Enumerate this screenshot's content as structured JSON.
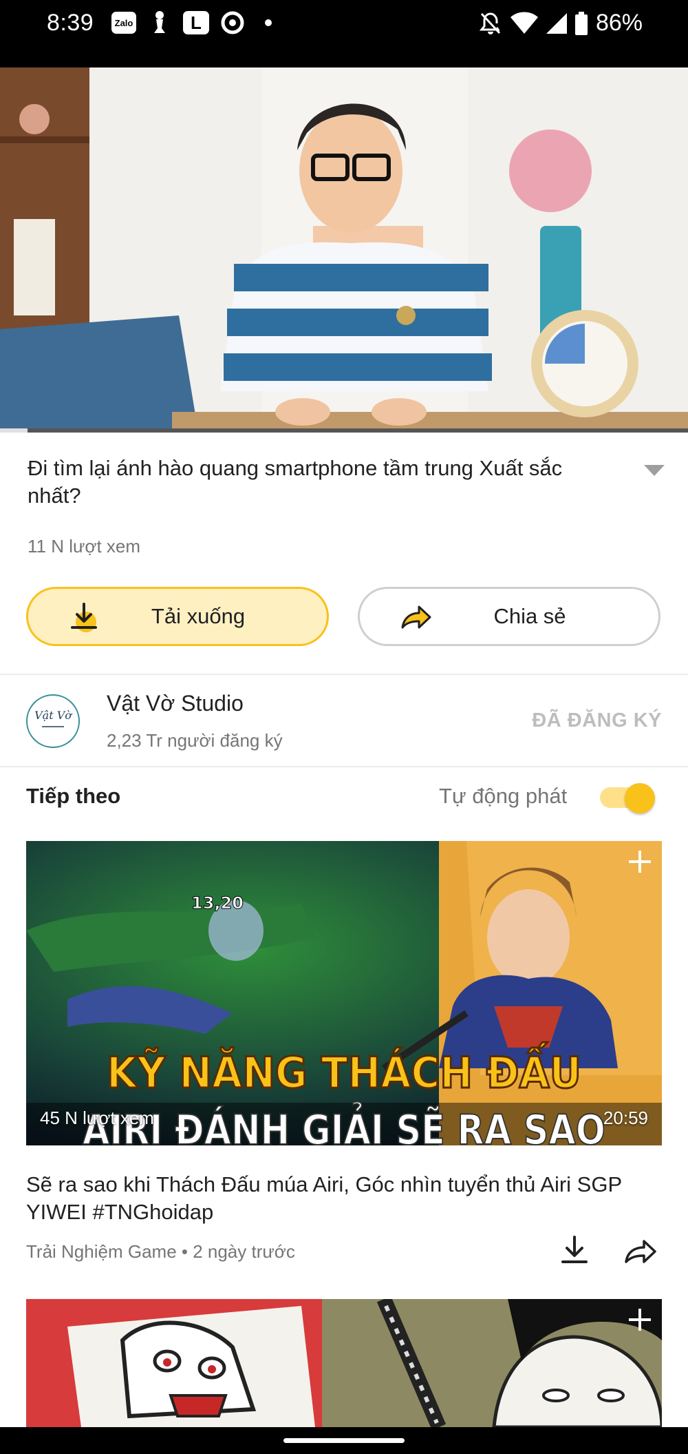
{
  "status_bar": {
    "time": "8:39",
    "left_icons": [
      "zalo-icon",
      "chess-pawn-icon",
      "l-app-icon",
      "circle-dot-icon",
      "dot-icon"
    ],
    "zalo_text": "Zalo",
    "l_text": "L",
    "right_icons": [
      "bell-off-icon",
      "wifi-icon",
      "signal-icon",
      "battery-icon"
    ],
    "battery": "86%"
  },
  "player": {
    "progress_fraction": 0.04
  },
  "video": {
    "title": "Đi tìm lại ánh hào quang smartphone tầm trung Xuất sắc nhất?",
    "views": "11 N lượt xem",
    "download_label": "Tải xuống",
    "share_label": "Chia sẻ"
  },
  "channel": {
    "name": "Vật Vờ Studio",
    "subscribers": "2,23 Tr người đăng ký",
    "subscribe_status": "ĐÃ ĐĂNG KÝ",
    "logo_text": "Vật Vờ"
  },
  "up_next": {
    "heading": "Tiếp theo",
    "autoplay_label": "Tự động phát",
    "autoplay_on": true
  },
  "items": [
    {
      "thumb_line1": "KỸ NĂNG THÁCH ĐẤU",
      "thumb_line2": "AIRI ĐÁNH GIẢI SẼ RA SAO",
      "thumb_hud": "13,20",
      "views": "45 N lượt xem",
      "duration": "20:59",
      "title": "Sẽ ra sao khi Thách Đấu múa Airi, Góc nhìn tuyển thủ Airi SGP YIWEI #TNGhoidap",
      "meta": "Trải Nghiệm Game • 2 ngày trước"
    }
  ],
  "colors": {
    "accent": "#f8c21a",
    "accent_light": "#fff0c2",
    "text_primary": "#212121",
    "text_secondary": "#757575",
    "subscribed": "#bdbdbd",
    "logo_teal": "#3a8f9a"
  }
}
